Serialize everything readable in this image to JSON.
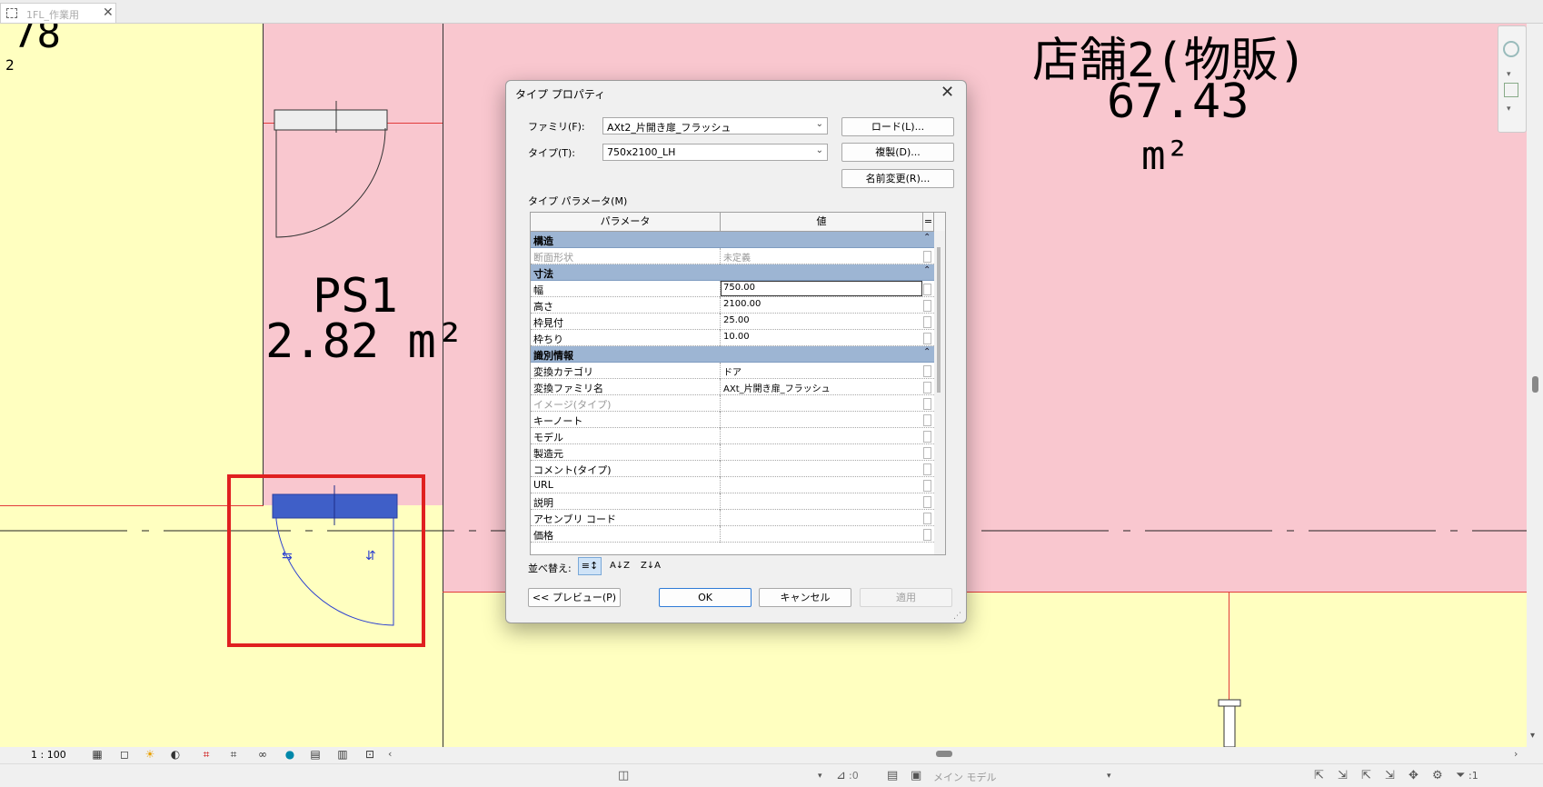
{
  "tab": {
    "title": "1FL_作業用",
    "close": "✕"
  },
  "canvas": {
    "room_partial_number": "78",
    "room_partial_sub": "2",
    "ps_name": "PS1",
    "ps_area": "2.82 m²",
    "shop_name": "店舗2(物販)",
    "shop_area": "67.43",
    "shop_unit": "m²"
  },
  "viewbar": {
    "scale": "1 : 100"
  },
  "status": {
    "model_label": "メイン モデル",
    "zero": ":0",
    "filter_count": ":1"
  },
  "dialog": {
    "title": "タイプ プロパティ",
    "family_label": "ファミリ(F):",
    "family_value": "AXt2_片開き扉_フラッシュ",
    "type_label": "タイプ(T):",
    "type_value": "750x2100_LH",
    "load_button": "ロード(L)...",
    "duplicate_button": "複製(D)...",
    "rename_button": "名前変更(R)...",
    "params_label": "タイプ パラメータ(M)",
    "col_param": "パラメータ",
    "col_value": "値",
    "col_extra": "=",
    "rows": [
      {
        "kind": "group",
        "name": "構造"
      },
      {
        "kind": "ro",
        "name": "断面形状",
        "value": "未定義"
      },
      {
        "kind": "group",
        "name": "寸法"
      },
      {
        "kind": "edit",
        "name": "幅",
        "value": "750.00"
      },
      {
        "kind": "row",
        "name": "高さ",
        "value": "2100.00"
      },
      {
        "kind": "row",
        "name": "枠見付",
        "value": "25.00"
      },
      {
        "kind": "row",
        "name": "枠ちり",
        "value": "10.00"
      },
      {
        "kind": "group",
        "name": "識別情報"
      },
      {
        "kind": "row",
        "name": "変換カテゴリ",
        "value": "ドア"
      },
      {
        "kind": "row",
        "name": "変換ファミリ名",
        "value": "AXt_片開き扉_フラッシュ"
      },
      {
        "kind": "ro",
        "name": "イメージ(タイプ)",
        "value": ""
      },
      {
        "kind": "row",
        "name": "キーノート",
        "value": ""
      },
      {
        "kind": "row",
        "name": "モデル",
        "value": ""
      },
      {
        "kind": "row",
        "name": "製造元",
        "value": ""
      },
      {
        "kind": "row",
        "name": "コメント(タイプ)",
        "value": ""
      },
      {
        "kind": "row",
        "name": "URL",
        "value": ""
      },
      {
        "kind": "row",
        "name": "説明",
        "value": ""
      },
      {
        "kind": "row",
        "name": "アセンブリ コード",
        "value": ""
      },
      {
        "kind": "row",
        "name": "価格",
        "value": ""
      }
    ],
    "sort_label": "並べ替え:",
    "preview_button": "<< プレビュー(P)",
    "ok_button": "OK",
    "cancel_button": "キャンセル",
    "apply_button": "適用"
  }
}
